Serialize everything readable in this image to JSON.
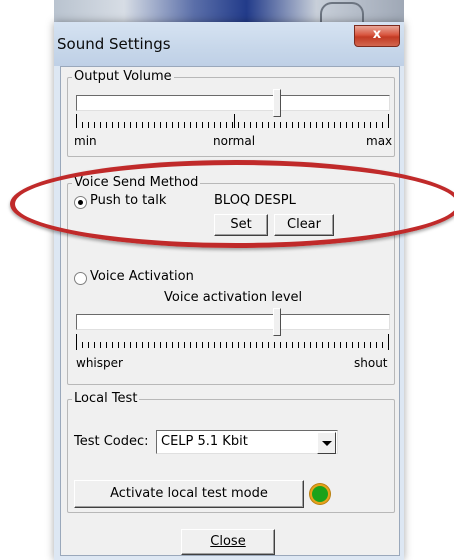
{
  "window": {
    "title": "Sound Settings",
    "close_glyph": "x"
  },
  "output_volume": {
    "label": "Output Volume",
    "level_percent": 64,
    "min_label": "min",
    "mid_label": "normal",
    "max_label": "max"
  },
  "voice_send": {
    "label": "Voice Send Method",
    "push_to_talk": {
      "label": "Push to talk",
      "selected": true
    },
    "hotkey_value": "BLOQ DESPL",
    "set_label": "Set",
    "clear_label": "Clear",
    "voice_activation": {
      "label": "Voice Activation",
      "selected": false
    },
    "activation_level_label": "Voice activation level",
    "activation_level_percent": 64,
    "whisper_label": "whisper",
    "shout_label": "shout"
  },
  "local_test": {
    "label": "Local Test",
    "codec_label": "Test Codec:",
    "codec_value": "CELP 5.1 Kbit",
    "activate_label": "Activate local test mode",
    "status_color": "#1aa21a"
  },
  "footer": {
    "close_label": "Close"
  },
  "colors": {
    "highlight_ellipse": "#c02a2a",
    "title_bar": "#c7d7ea",
    "client_bg": "#f0f0f0"
  }
}
